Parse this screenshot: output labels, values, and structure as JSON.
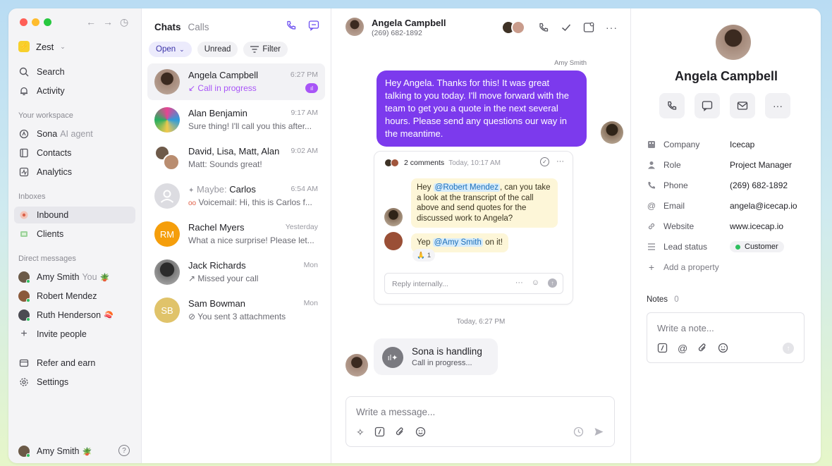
{
  "colors": {
    "accent": "#6b4ef0",
    "bubble": "#7c3aed",
    "live_badge": "#a855f7",
    "online": "#2fbf5f",
    "rachel_avatar": "#f59e0b",
    "sam_avatar": "#e0c36a"
  },
  "sidebar": {
    "workspace": "Zest",
    "nav": [
      {
        "label": "Search",
        "icon": "search-icon"
      },
      {
        "label": "Activity",
        "icon": "bell-icon"
      }
    ],
    "workspace_section": "Your workspace",
    "workspace_items": [
      {
        "label": "Sona",
        "suffix": "AI agent",
        "icon": "sparkle-icon"
      },
      {
        "label": "Contacts",
        "icon": "contacts-icon"
      },
      {
        "label": "Analytics",
        "icon": "analytics-icon"
      }
    ],
    "inboxes_section": "Inboxes",
    "inboxes": [
      {
        "label": "Inbound",
        "icon": "inbound-icon"
      },
      {
        "label": "Clients",
        "icon": "clients-icon"
      }
    ],
    "dm_section": "Direct messages",
    "dms": [
      {
        "label": "Amy Smith",
        "suffix": "You",
        "emoji": "🪴"
      },
      {
        "label": "Robert Mendez",
        "suffix": "",
        "emoji": ""
      },
      {
        "label": "Ruth Henderson",
        "suffix": "",
        "emoji": "🍣"
      }
    ],
    "invite": "Invite people",
    "refer": "Refer and earn",
    "settings": "Settings",
    "footer_user": "Amy Smith",
    "footer_emoji": "🪴"
  },
  "chatlist": {
    "tabs": [
      "Chats",
      "Calls"
    ],
    "filters": [
      "Open",
      "Unread",
      "Filter"
    ],
    "chats": [
      {
        "name": "Angela Campbell",
        "time": "6:27 PM",
        "preview": "Call in progress"
      },
      {
        "name": "Alan Benjamin",
        "time": "9:17 AM",
        "preview": "Sure thing! I'll call you this after..."
      },
      {
        "name": "David, Lisa, Matt, Alan",
        "time": "9:02 AM",
        "preview": "Matt: Sounds great!"
      },
      {
        "name_prefix": "Maybe:",
        "name": "Carlos",
        "time": "6:54 AM",
        "preview": "Voicemail: Hi, this is Carlos f..."
      },
      {
        "name": "Rachel Myers",
        "time": "Yesterday",
        "preview": "What a nice surprise! Please let...",
        "initials": "RM"
      },
      {
        "name": "Jack Richards",
        "time": "Mon",
        "preview": "Missed your call"
      },
      {
        "name": "Sam Bowman",
        "time": "Mon",
        "preview": "You sent 3 attachments",
        "initials": "SB"
      }
    ]
  },
  "conversation": {
    "contact_name": "Angela Campbell",
    "contact_phone": "(269) 682-1892",
    "sender": "Amy Smith",
    "message": "Hey Angela. Thanks for this! It was great talking to you today. I'll move forward with the team to get you a quote in the next several hours. Please send any questions our way in the meantime.",
    "thread": {
      "count": "2 comments",
      "time": "Today, 10:17 AM",
      "comment1_pre": "Hey",
      "comment1_mention": "@Robert Mendez",
      "comment1_post": ", can you take a look at the transcript of the call above and send quotes for the discussed work to Angela?",
      "comment2_pre": "Yep",
      "comment2_mention": "@Amy Smith",
      "comment2_post": "on it!",
      "reaction_emoji": "🙏",
      "reaction_count": "1",
      "reply_placeholder": "Reply internally..."
    },
    "timestamp": "Today, 6:27 PM",
    "sona_title": "Sona is handling",
    "sona_sub": "Call in progress...",
    "composer_placeholder": "Write a message..."
  },
  "contact": {
    "name": "Angela Campbell",
    "props": [
      {
        "key": "Company",
        "value": "Icecap"
      },
      {
        "key": "Role",
        "value": "Project Manager"
      },
      {
        "key": "Phone",
        "value": "(269) 682-1892"
      },
      {
        "key": "Email",
        "value": "angela@icecap.io"
      },
      {
        "key": "Website",
        "value": "www.icecap.io"
      },
      {
        "key": "Lead status",
        "value": "Customer"
      }
    ],
    "add_property": "Add a property",
    "notes_label": "Notes",
    "notes_count": "0",
    "notes_placeholder": "Write a note..."
  }
}
